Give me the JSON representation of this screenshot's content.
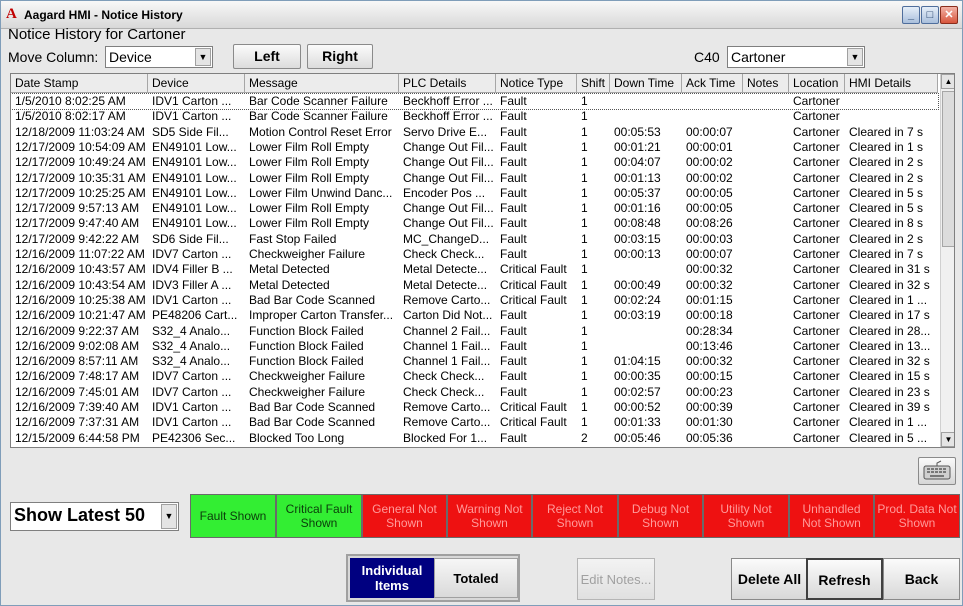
{
  "window": {
    "title": "Aagard HMI - Notice History",
    "logo_glyph": "A",
    "minimize_glyph": "_",
    "maximize_glyph": "□",
    "close_glyph": "✕"
  },
  "page_title": "Notice History for Cartoner",
  "move_column": {
    "label": "Move Column:",
    "selected": "Device",
    "left_label": "Left",
    "right_label": "Right"
  },
  "machine": {
    "label": "C40",
    "selected": "Cartoner"
  },
  "dropdown_arrow": "▼",
  "table": {
    "columns": [
      "Date Stamp",
      "Device",
      "Message",
      "PLC Details",
      "Notice Type",
      "Shift",
      "Down Time",
      "Ack Time",
      "Notes",
      "Location",
      "HMI Details"
    ],
    "rows": [
      [
        "1/5/2010 8:02:25 AM",
        "IDV1   Carton ...",
        "Bar Code Scanner Failure",
        "Beckhoff Error ...",
        "Fault",
        "1",
        "",
        "",
        "",
        "Cartoner",
        ""
      ],
      [
        "1/5/2010 8:02:17 AM",
        "IDV1   Carton ...",
        "Bar Code Scanner Failure",
        "Beckhoff Error ...",
        "Fault",
        "1",
        "",
        "",
        "",
        "Cartoner",
        ""
      ],
      [
        "12/18/2009 11:03:24 AM",
        "SD5   Side Fil...",
        "Motion Control Reset Error",
        "Servo Drive E...",
        "Fault",
        "1",
        "00:05:53",
        "00:00:07",
        "",
        "Cartoner",
        "Cleared in 7 s"
      ],
      [
        "12/17/2009 10:54:09 AM",
        "EN49101   Low...",
        "Lower Film Roll Empty",
        "Change Out Fil...",
        "Fault",
        "1",
        "00:01:21",
        "00:00:01",
        "",
        "Cartoner",
        "Cleared in 1 s"
      ],
      [
        "12/17/2009 10:49:24 AM",
        "EN49101   Low...",
        "Lower Film Roll Empty",
        "Change Out Fil...",
        "Fault",
        "1",
        "00:04:07",
        "00:00:02",
        "",
        "Cartoner",
        "Cleared in 2 s"
      ],
      [
        "12/17/2009 10:35:31 AM",
        "EN49101   Low...",
        "Lower Film Roll Empty",
        "Change Out Fil...",
        "Fault",
        "1",
        "00:01:13",
        "00:00:02",
        "",
        "Cartoner",
        "Cleared in 2 s"
      ],
      [
        "12/17/2009 10:25:25 AM",
        "EN49101   Low...",
        "Lower Film Unwind Danc...",
        "Encoder Pos ...",
        "Fault",
        "1",
        "00:05:37",
        "00:00:05",
        "",
        "Cartoner",
        "Cleared in 5 s"
      ],
      [
        "12/17/2009 9:57:13 AM",
        "EN49101   Low...",
        "Lower Film Roll Empty",
        "Change Out Fil...",
        "Fault",
        "1",
        "00:01:16",
        "00:00:05",
        "",
        "Cartoner",
        "Cleared in 5 s"
      ],
      [
        "12/17/2009 9:47:40 AM",
        "EN49101   Low...",
        "Lower Film Roll Empty",
        "Change Out Fil...",
        "Fault",
        "1",
        "00:08:48",
        "00:08:26",
        "",
        "Cartoner",
        "Cleared in 8 s"
      ],
      [
        "12/17/2009 9:42:22 AM",
        "SD6   Side Fil...",
        "Fast Stop Failed",
        "MC_ChangeD...",
        "Fault",
        "1",
        "00:03:15",
        "00:00:03",
        "",
        "Cartoner",
        "Cleared in 2 s"
      ],
      [
        "12/16/2009 11:07:22 AM",
        "IDV7   Carton ...",
        "Checkweigher Failure",
        "Check Check...",
        "Fault",
        "1",
        "00:00:13",
        "00:00:07",
        "",
        "Cartoner",
        "Cleared in 7 s"
      ],
      [
        "12/16/2009 10:43:57 AM",
        "IDV4   Filler B ...",
        "Metal Detected",
        "Metal Detecte...",
        "Critical Fault",
        "1",
        "",
        "00:00:32",
        "",
        "Cartoner",
        "Cleared in 31 s"
      ],
      [
        "12/16/2009 10:43:54 AM",
        "IDV3   Filler A ...",
        "Metal Detected",
        "Metal Detecte...",
        "Critical Fault",
        "1",
        "00:00:49",
        "00:00:32",
        "",
        "Cartoner",
        "Cleared in 32 s"
      ],
      [
        "12/16/2009 10:25:38 AM",
        "IDV1   Carton ...",
        "Bad Bar Code Scanned",
        "Remove Carto...",
        "Critical Fault",
        "1",
        "00:02:24",
        "00:01:15",
        "",
        "Cartoner",
        "Cleared in 1 ..."
      ],
      [
        "12/16/2009 10:21:47 AM",
        "PE48206   Cart...",
        "Improper Carton Transfer...",
        "Carton Did Not...",
        "Fault",
        "1",
        "00:03:19",
        "00:00:18",
        "",
        "Cartoner",
        "Cleared in 17 s"
      ],
      [
        "12/16/2009 9:22:37 AM",
        "S32_4   Analo...",
        "Function Block Failed",
        "Channel 2 Fail...",
        "Fault",
        "1",
        "",
        "00:28:34",
        "",
        "Cartoner",
        "Cleared in 28..."
      ],
      [
        "12/16/2009 9:02:08 AM",
        "S32_4   Analo...",
        "Function Block Failed",
        "Channel 1 Fail...",
        "Fault",
        "1",
        "",
        "00:13:46",
        "",
        "Cartoner",
        "Cleared in 13..."
      ],
      [
        "12/16/2009 8:57:11 AM",
        "S32_4   Analo...",
        "Function Block Failed",
        "Channel 1 Fail...",
        "Fault",
        "1",
        "01:04:15",
        "00:00:32",
        "",
        "Cartoner",
        "Cleared in 32 s"
      ],
      [
        "12/16/2009 7:48:17 AM",
        "IDV7   Carton ...",
        "Checkweigher Failure",
        "Check Check...",
        "Fault",
        "1",
        "00:00:35",
        "00:00:15",
        "",
        "Cartoner",
        "Cleared in 15 s"
      ],
      [
        "12/16/2009 7:45:01 AM",
        "IDV7   Carton ...",
        "Checkweigher Failure",
        "Check Check...",
        "Fault",
        "1",
        "00:02:57",
        "00:00:23",
        "",
        "Cartoner",
        "Cleared in 23 s"
      ],
      [
        "12/16/2009 7:39:40 AM",
        "IDV1   Carton ...",
        "Bad Bar Code Scanned",
        "Remove Carto...",
        "Critical Fault",
        "1",
        "00:00:52",
        "00:00:39",
        "",
        "Cartoner",
        "Cleared in 39 s"
      ],
      [
        "12/16/2009 7:37:31 AM",
        "IDV1   Carton ...",
        "Bad Bar Code Scanned",
        "Remove Carto...",
        "Critical Fault",
        "1",
        "00:01:33",
        "00:01:30",
        "",
        "Cartoner",
        "Cleared in 1 ..."
      ],
      [
        "12/15/2009 6:44:58 PM",
        "PE42306   Sec...",
        "Blocked Too Long",
        "Blocked For 1...",
        "Fault",
        "2",
        "00:05:46",
        "00:05:36",
        "",
        "Cartoner",
        "Cleared in 5 ..."
      ]
    ]
  },
  "scroll": {
    "up_glyph": "▲",
    "down_glyph": "▼"
  },
  "keyboard_icon": "keyboard-icon",
  "show_latest": {
    "selected": "Show Latest 50"
  },
  "filters": [
    {
      "label": "Fault Shown",
      "state": "shown",
      "color": "#33ee33"
    },
    {
      "label": "Critical Fault Shown",
      "state": "shown",
      "color": "#33ee33"
    },
    {
      "label": "General Not Shown",
      "state": "hidden",
      "color": "#ee1111"
    },
    {
      "label": "Warning Not Shown",
      "state": "hidden",
      "color": "#ee1111"
    },
    {
      "label": "Reject Not Shown",
      "state": "hidden",
      "color": "#ee1111"
    },
    {
      "label": "Debug Not Shown",
      "state": "hidden",
      "color": "#ee1111"
    },
    {
      "label": "Utility Not Shown",
      "state": "hidden",
      "color": "#ee1111"
    },
    {
      "label": "Unhandled Not Shown",
      "state": "hidden",
      "color": "#ee1111"
    },
    {
      "label": "Prod. Data Not Shown",
      "state": "hidden",
      "color": "#ee1111"
    }
  ],
  "view_toggle": {
    "individual_label": "Individual Items",
    "totaled_label": "Totaled",
    "selected": "Individual Items"
  },
  "actions": {
    "edit_notes_label": "Edit Notes...",
    "delete_all_label": "Delete All",
    "refresh_label": "Refresh",
    "back_label": "Back"
  }
}
